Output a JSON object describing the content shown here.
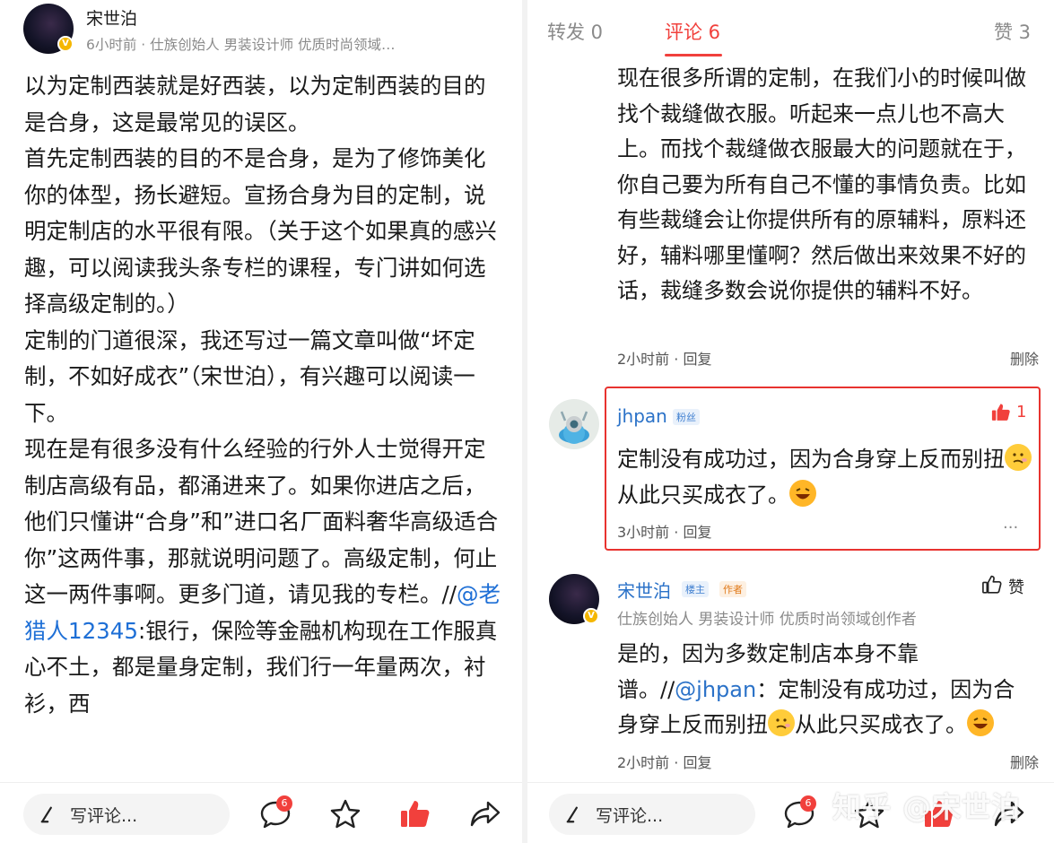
{
  "left": {
    "author": {
      "name": "宋世泊",
      "meta": "6小时前 · 仕族创始人 男装设计师 优质时尚领域…",
      "verified_mark": "V"
    },
    "paragraphs": [
      "以为定制西装就是好西装，以为定制西装的目的是合身，这是最常见的误区。",
      "首先定制西装的目的不是合身，是为了修饰美化你的体型，扬长避短。宣扬合身为目的定制，说明定制店的水平很有限。（关于这个如果真的感兴趣，可以阅读我头条专栏的课程，专门讲如何选择高级定制的。）",
      "定制的门道很深，我还写过一篇文章叫做“坏定制，不如好成衣”（宋世泊），有兴趣可以阅读一下。"
    ],
    "para4_before": "现在是有很多没有什么经验的行外人士觉得开定制店高级有品，都涌进来了。如果你进店之后，他们只懂讲“合身”和”进口名厂面料奢华高级适合你”这两件事，那就说明问题了。高级定制，何止这一两件事啊。更多门道，请见我的专栏。//",
    "para4_mention": "@老猎人12345",
    "para4_after": ":银行，保险等金融机构现在工作服真心不土，都是量身定制，我们行一年量两次，衬衫，西",
    "bottom": {
      "comment_placeholder": "写评论...",
      "comment_count": "6"
    }
  },
  "right": {
    "tabs": [
      {
        "label": "转发 0"
      },
      {
        "label": "评论 6"
      },
      {
        "label": "赞 3"
      }
    ],
    "comment1": {
      "text": "现在很多所谓的定制，在我们小的时候叫做找个裁缝做衣服。听起来一点儿也不高大上。而找个裁缝做衣服最大的问题就在于，你自己要为所有自己不懂的事情负责。比如有些裁缝会让你提供所有的原辅料，原料还好，辅料哪里懂啊？然后做出来效果不好的话，裁缝多数会说你提供的辅料不好。",
      "meta": "2小时前 · 回复",
      "delete": "删除"
    },
    "comment2": {
      "user": "jhpan",
      "tag": "粉丝",
      "likes": "1",
      "text_a": "定制没有成功过，因为合身穿上反而别扭",
      "text_b": "从此只买成衣了。",
      "meta": "3小时前 · 回复",
      "more": "···"
    },
    "comment3": {
      "user": "宋世泊",
      "tag_owner": "楼主",
      "tag_author": "作者",
      "like_label": "赞",
      "subtitle": "仕族创始人 男装设计师 优质时尚领域创作者",
      "text_a": "是的，因为多数定制店本身不靠谱。//",
      "mention": "@jhpan",
      "text_b": "：定制没有成功过，因为合身穿上反而别扭",
      "text_c": "从此只买成衣了。",
      "meta": "2小时前 · 回复",
      "delete": "删除"
    },
    "bottom": {
      "comment_placeholder": "写评论...",
      "comment_count": "6"
    },
    "watermark": "知乎 @宋世泊"
  },
  "colors": {
    "accent": "#f1403c",
    "link": "#2b72c8",
    "highlight_border": "#e8332f",
    "verified": "#f5b700"
  },
  "icons": [
    "pen-icon",
    "comment-icon",
    "star-icon",
    "thumb-up-icon",
    "share-icon",
    "like-outline-icon"
  ]
}
